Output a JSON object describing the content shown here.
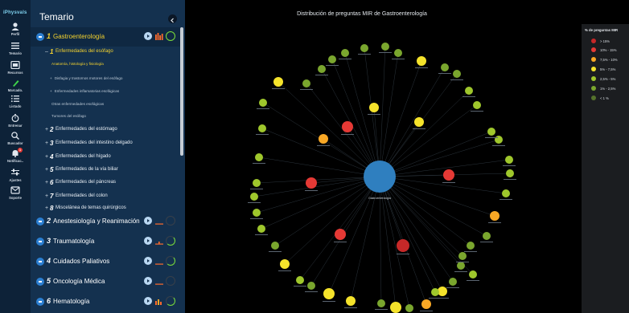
{
  "rail": {
    "logo": "iPhysvals",
    "items": [
      {
        "label": "Perfil",
        "icon": "profile-icon"
      },
      {
        "label": "Temario",
        "icon": "list-icon"
      },
      {
        "label": "Recursos",
        "icon": "resources-icon"
      },
      {
        "label": "Marcado.",
        "icon": "highlight-pen-icon"
      },
      {
        "label": "Listado",
        "icon": "checklist-icon"
      },
      {
        "label": "Entrenar",
        "icon": "stopwatch-icon"
      },
      {
        "label": "Buscador",
        "icon": "search-icon"
      },
      {
        "label": "Notificac..",
        "icon": "bell-icon",
        "badge": "1"
      },
      {
        "label": "Ajustes",
        "icon": "sliders-icon"
      },
      {
        "label": "Soporte",
        "icon": "mail-icon"
      }
    ]
  },
  "panel": {
    "title": "Temario",
    "sections": [
      {
        "num": "1",
        "label": "Gastroenterología",
        "progress_ring": "complete"
      },
      {
        "num": "2",
        "label": "Anestesiología y Reanimación"
      },
      {
        "num": "3",
        "label": "Traumatología"
      },
      {
        "num": "4",
        "label": "Cuidados Paliativos"
      },
      {
        "num": "5",
        "label": "Oncología Médica"
      },
      {
        "num": "6",
        "label": "Hematología"
      }
    ],
    "gastro_subtopics": [
      {
        "mark": "–",
        "num": "1",
        "label": "Enfermedades del esófago"
      },
      {
        "mark": "+",
        "num": "2",
        "label": "Enfermedades del estómago"
      },
      {
        "mark": "+",
        "num": "3",
        "label": "Enfermedades del intestino delgado"
      },
      {
        "mark": "+",
        "num": "4",
        "label": "Enfermedades del hígado"
      },
      {
        "mark": "+",
        "num": "5",
        "label": "Enfermedades de la vía biliar"
      },
      {
        "mark": "+",
        "num": "6",
        "label": "Enfermedades del páncreas"
      },
      {
        "mark": "+",
        "num": "7",
        "label": "Enfermedades del colon"
      },
      {
        "mark": "+",
        "num": "8",
        "label": "Miscelánea de temas quirúrgicos"
      }
    ],
    "esofago_leaves": [
      {
        "mark": "",
        "label": "Anatomía, histología y fisiología"
      },
      {
        "mark": "+",
        "label": "Disfagia y trastornos motores del esófago"
      },
      {
        "mark": "+",
        "label": "Enfermedades inflamatorias esofágicas"
      },
      {
        "mark": "",
        "label": "Otras enfermedades esofágicas"
      },
      {
        "mark": "",
        "label": "Tumores del esófago"
      }
    ]
  },
  "main": {
    "chart_title": "Distribución de preguntas MIR de Gastroenterología",
    "center_label": "Gastroenterología",
    "legend": {
      "title": "% de preguntas MIR",
      "items": [
        {
          "label": "> 15%",
          "color": "#c62828"
        },
        {
          "label": "10% - 15%",
          "color": "#e53935"
        },
        {
          "label": "7,5% - 10%",
          "color": "#f9a825"
        },
        {
          "label": "5% - 7,5%",
          "color": "#f5e32b"
        },
        {
          "label": "2,5% - 5%",
          "color": "#9fc72c"
        },
        {
          "label": "1% - 2,5%",
          "color": "#7aa62e"
        },
        {
          "label": "< 1 %",
          "color": "#55722c"
        }
      ]
    }
  }
}
